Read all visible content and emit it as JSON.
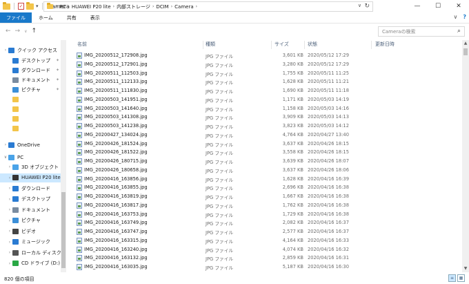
{
  "window": {
    "title": "Camera",
    "minimize": "—",
    "maximize": "☐",
    "close": "✕"
  },
  "ribbon": {
    "tabs": [
      "ファイル",
      "ホーム",
      "共有",
      "表示"
    ],
    "expand": "∨",
    "help": "?"
  },
  "address": {
    "crumbs": [
      "PC",
      "HUAWEI P20 lite",
      "内部ストレージ",
      "DCIM",
      "Camera"
    ],
    "back": "←",
    "forward": "→",
    "dropdown": "∨",
    "up": "↑",
    "refresh": "↻"
  },
  "search": {
    "placeholder": "Cameraの検索"
  },
  "nav": {
    "quick_access": "クイック アクセス",
    "items": [
      {
        "label": "デスクトップ",
        "pinned": true,
        "color": "#2a7bd2"
      },
      {
        "label": "ダウンロード",
        "pinned": true,
        "color": "#2a7bd2"
      },
      {
        "label": "ドキュメント",
        "pinned": true,
        "color": "#7a8ca0"
      },
      {
        "label": "ピクチャ",
        "pinned": true,
        "color": "#3c8fd8"
      },
      {
        "label": "",
        "pinned": false,
        "color": "#f3c54a"
      },
      {
        "label": "",
        "pinned": false,
        "color": "#f3c54a"
      },
      {
        "label": "",
        "pinned": false,
        "color": "#f3c54a"
      },
      {
        "label": "",
        "pinned": false,
        "color": "#f3c54a"
      }
    ],
    "onedrive": "OneDrive",
    "pc": "PC",
    "pc_items": [
      {
        "label": "3D オブジェクト",
        "color": "#4aa3e8",
        "selected": false
      },
      {
        "label": "HUAWEI P20 lite",
        "color": "#333",
        "selected": true
      },
      {
        "label": "ダウンロード",
        "color": "#2a7bd2",
        "selected": false
      },
      {
        "label": "デスクトップ",
        "color": "#2a7bd2",
        "selected": false
      },
      {
        "label": "ドキュメント",
        "color": "#7a8ca0",
        "selected": false
      },
      {
        "label": "ピクチャ",
        "color": "#3c8fd8",
        "selected": false
      },
      {
        "label": "ビデオ",
        "color": "#444",
        "selected": false
      },
      {
        "label": "ミュージック",
        "color": "#2a7bd2",
        "selected": false
      },
      {
        "label": "ローカル ディスク (C",
        "color": "#555",
        "selected": false
      },
      {
        "label": "CD ドライブ (D:) H",
        "color": "#2aa845",
        "selected": false
      }
    ]
  },
  "columns": {
    "name": "名前",
    "type": "種類",
    "size": "サイズ",
    "status": "状態",
    "modified": "更新日時"
  },
  "files": [
    {
      "name": "IMG_20200512_172908.jpg",
      "type": "JPG ファイル",
      "size": "3,601 KB",
      "date": "2020/05/12 17:29"
    },
    {
      "name": "IMG_20200512_172901.jpg",
      "type": "JPG ファイル",
      "size": "3,280 KB",
      "date": "2020/05/12 17:29"
    },
    {
      "name": "IMG_20200511_112503.jpg",
      "type": "JPG ファイル",
      "size": "1,755 KB",
      "date": "2020/05/11 11:25"
    },
    {
      "name": "IMG_20200511_112133.jpg",
      "type": "JPG ファイル",
      "size": "1,628 KB",
      "date": "2020/05/11 11:21"
    },
    {
      "name": "IMG_20200511_111830.jpg",
      "type": "JPG ファイル",
      "size": "1,690 KB",
      "date": "2020/05/11 11:18"
    },
    {
      "name": "IMG_20200503_141951.jpg",
      "type": "JPG ファイル",
      "size": "1,171 KB",
      "date": "2020/05/03 14:19"
    },
    {
      "name": "IMG_20200503_141640.jpg",
      "type": "JPG ファイル",
      "size": "1,158 KB",
      "date": "2020/05/03 14:16"
    },
    {
      "name": "IMG_20200503_141308.jpg",
      "type": "JPG ファイル",
      "size": "3,909 KB",
      "date": "2020/05/03 14:13"
    },
    {
      "name": "IMG_20200503_141238.jpg",
      "type": "JPG ファイル",
      "size": "3,823 KB",
      "date": "2020/05/03 14:12"
    },
    {
      "name": "IMG_20200427_134024.jpg",
      "type": "JPG ファイル",
      "size": "4,764 KB",
      "date": "2020/04/27 13:40"
    },
    {
      "name": "IMG_20200426_181524.jpg",
      "type": "JPG ファイル",
      "size": "3,637 KB",
      "date": "2020/04/26 18:15"
    },
    {
      "name": "IMG_20200426_181522.jpg",
      "type": "JPG ファイル",
      "size": "3,558 KB",
      "date": "2020/04/26 18:15"
    },
    {
      "name": "IMG_20200426_180715.jpg",
      "type": "JPG ファイル",
      "size": "3,639 KB",
      "date": "2020/04/26 18:07"
    },
    {
      "name": "IMG_20200426_180658.jpg",
      "type": "JPG ファイル",
      "size": "3,637 KB",
      "date": "2020/04/26 18:06"
    },
    {
      "name": "IMG_20200416_163856.jpg",
      "type": "JPG ファイル",
      "size": "1,628 KB",
      "date": "2020/04/16 16:39"
    },
    {
      "name": "IMG_20200416_163855.jpg",
      "type": "JPG ファイル",
      "size": "2,696 KB",
      "date": "2020/04/16 16:38"
    },
    {
      "name": "IMG_20200416_163819.jpg",
      "type": "JPG ファイル",
      "size": "1,667 KB",
      "date": "2020/04/16 16:38"
    },
    {
      "name": "IMG_20200416_163817.jpg",
      "type": "JPG ファイル",
      "size": "1,762 KB",
      "date": "2020/04/16 16:38"
    },
    {
      "name": "IMG_20200416_163753.jpg",
      "type": "JPG ファイル",
      "size": "1,729 KB",
      "date": "2020/04/16 16:38"
    },
    {
      "name": "IMG_20200416_163749.jpg",
      "type": "JPG ファイル",
      "size": "2,082 KB",
      "date": "2020/04/16 16:37"
    },
    {
      "name": "IMG_20200416_163747.jpg",
      "type": "JPG ファイル",
      "size": "2,577 KB",
      "date": "2020/04/16 16:37"
    },
    {
      "name": "IMG_20200416_163315.jpg",
      "type": "JPG ファイル",
      "size": "4,164 KB",
      "date": "2020/04/16 16:33"
    },
    {
      "name": "IMG_20200416_163240.jpg",
      "type": "JPG ファイル",
      "size": "4,074 KB",
      "date": "2020/04/16 16:32"
    },
    {
      "name": "IMG_20200416_163132.jpg",
      "type": "JPG ファイル",
      "size": "2,859 KB",
      "date": "2020/04/16 16:31"
    },
    {
      "name": "IMG_20200416_163035.jpg",
      "type": "JPG ファイル",
      "size": "5,187 KB",
      "date": "2020/04/16 16:30"
    }
  ],
  "status": {
    "count": "820 個の項目"
  }
}
